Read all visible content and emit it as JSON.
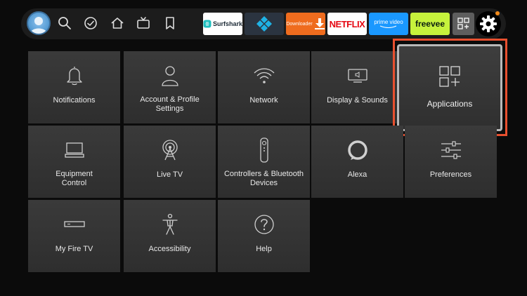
{
  "topbar": {
    "profile_icon": "profile-avatar-icon",
    "nav": [
      {
        "name": "search",
        "icon": "search-icon"
      },
      {
        "name": "check",
        "icon": "check-circle-icon"
      },
      {
        "name": "home",
        "icon": "home-icon"
      },
      {
        "name": "live",
        "icon": "tv-icon"
      },
      {
        "name": "watchlist",
        "icon": "bookmark-icon"
      }
    ],
    "apps": {
      "surfshark": "Surfshark",
      "kodi": "",
      "downloader": "Downloader",
      "netflix": "NETFLIX",
      "prime": "prime video",
      "freevee": "freevee"
    },
    "settings_icon": "gear-icon",
    "notification_color": "#f28a1a"
  },
  "tiles": {
    "notifications": "Notifications",
    "account_line1": "Account & Profile",
    "account_line2": "Settings",
    "network": "Network",
    "display": "Display & Sounds",
    "applications": "Applications",
    "equipment_line1": "Equipment",
    "equipment_line2": "Control",
    "live_tv": "Live TV",
    "controllers_line1": "Controllers & Bluetooth",
    "controllers_line2": "Devices",
    "alexa": "Alexa",
    "preferences": "Preferences",
    "my_fire_tv": "My Fire TV",
    "accessibility": "Accessibility",
    "help": "Help"
  },
  "colors": {
    "highlight": "#e8502f",
    "alexa_ring": "#cfcfcf"
  }
}
